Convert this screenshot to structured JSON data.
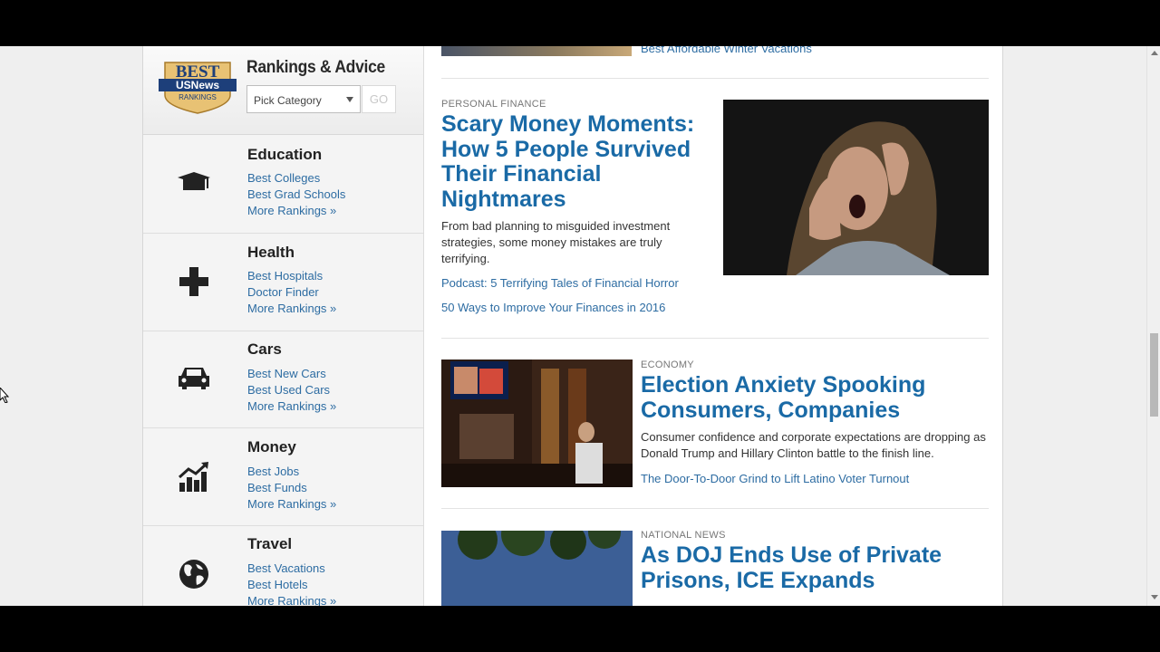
{
  "rankings": {
    "badge": {
      "best": "BEST",
      "brand": "USNews",
      "sub": "RANKINGS"
    },
    "title": "Rankings & Advice",
    "select_value": "Pick Category",
    "go_label": "GO",
    "categories": [
      {
        "title": "Education",
        "icon": "graduation-cap-icon",
        "links": [
          "Best Colleges",
          "Best Grad Schools",
          "More Rankings »"
        ]
      },
      {
        "title": "Health",
        "icon": "medical-cross-icon",
        "links": [
          "Best Hospitals",
          "Doctor Finder",
          "More Rankings »"
        ]
      },
      {
        "title": "Cars",
        "icon": "car-icon",
        "links": [
          "Best New Cars",
          "Best Used Cars",
          "More Rankings »"
        ]
      },
      {
        "title": "Money",
        "icon": "chart-growth-icon",
        "links": [
          "Best Jobs",
          "Best Funds",
          "More Rankings »"
        ]
      },
      {
        "title": "Travel",
        "icon": "globe-icon",
        "links": [
          "Best Vacations",
          "Best Hotels",
          "More Rankings »"
        ]
      }
    ]
  },
  "articles": {
    "top_link": "Best Affordable Winter Vacations",
    "a1": {
      "kicker": "PERSONAL FINANCE",
      "headline": "Scary Money Moments: How 5 People Survived Their Financial Nightmares",
      "dek": "From bad planning to misguided investment strategies, some money mistakes are truly terrifying.",
      "related": [
        "Podcast: 5 Terrifying Tales of Financial Horror",
        "50 Ways to Improve Your Finances in 2016"
      ]
    },
    "a2": {
      "kicker": "ECONOMY",
      "headline": "Election Anxiety Spooking Consumers, Companies",
      "dek": "Consumer confidence and corporate expectations are dropping as Donald Trump and Hillary Clinton battle to the finish line.",
      "related": [
        "The Door-To-Door Grind to Lift Latino Voter Turnout"
      ]
    },
    "a3": {
      "kicker": "NATIONAL NEWS",
      "headline": "As DOJ Ends Use of Private Prisons, ICE Expands"
    }
  },
  "colors": {
    "link": "#2d6ca2",
    "headline": "#1a6aa6",
    "badge_navy": "#1d3f7a",
    "badge_gold": "#d9a74a"
  }
}
